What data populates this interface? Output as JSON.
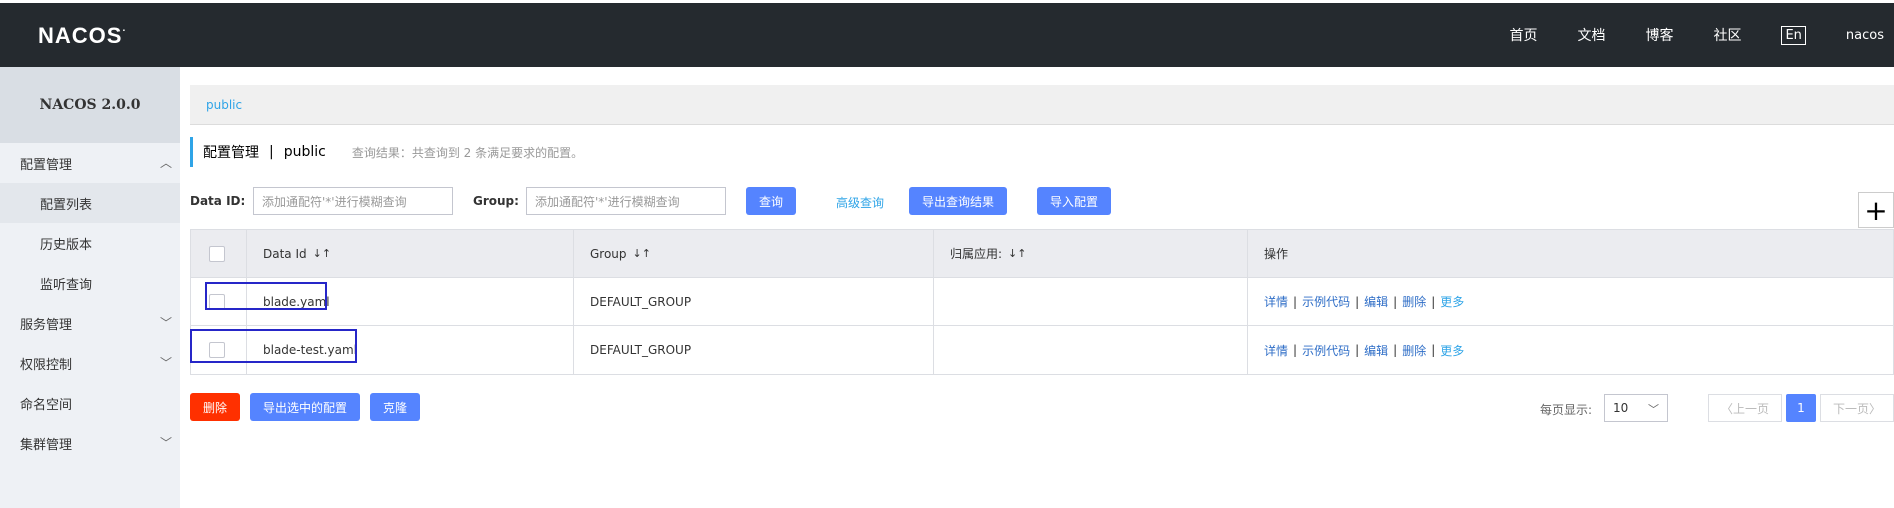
{
  "brand": {
    "logo_text": "NACOS",
    "logo_dot": "."
  },
  "topnav": {
    "items": [
      "首页",
      "文档",
      "博客",
      "社区"
    ],
    "lang": "En",
    "user": "nacos"
  },
  "sidebar": {
    "version": "NACOS 2.0.0",
    "groups": [
      {
        "label": "配置管理",
        "expanded": true,
        "items": [
          "配置列表",
          "历史版本",
          "监听查询"
        ]
      },
      {
        "label": "服务管理",
        "expanded": false
      },
      {
        "label": "权限控制",
        "expanded": false
      },
      {
        "label": "命名空间",
        "expanded": false
      },
      {
        "label": "集群管理",
        "expanded": false
      }
    ]
  },
  "namespace_bar": {
    "current": "public"
  },
  "title": {
    "main": "配置管理",
    "separator": "|",
    "namespace": "public",
    "result": "查询结果：共查询到 2 条满足要求的配置。"
  },
  "search": {
    "data_id_label": "Data ID:",
    "data_id_placeholder": "添加通配符'*'进行模糊查询",
    "group_label": "Group:",
    "group_placeholder": "添加通配符'*'进行模糊查询",
    "query_button": "查询",
    "advanced_link": "高级查询",
    "export_button": "导出查询结果",
    "import_button": "导入配置",
    "add_button": "+"
  },
  "table": {
    "headers": [
      "Data Id",
      "Group",
      "归属应用:",
      "操作"
    ],
    "rows": [
      {
        "data_id": "blade.yaml",
        "group": "DEFAULT_GROUP",
        "app": ""
      },
      {
        "data_id": "blade-test.yaml",
        "group": "DEFAULT_GROUP",
        "app": ""
      }
    ],
    "ops": [
      "详情",
      "示例代码",
      "编辑",
      "删除",
      "更多"
    ],
    "sort_glyph": "↓↑"
  },
  "footer": {
    "delete_button": "删除",
    "export_selected_button": "导出选中的配置",
    "clone_button": "克隆",
    "page_size_label": "每页显示:",
    "page_size_value": "10",
    "prev_label": "上一页",
    "current_page": "1",
    "next_label": "下一页"
  },
  "colors": {
    "topbar": "#252a2f",
    "primary": "#5584ff",
    "link": "#2fa4e7",
    "danger": "#ff3000",
    "highlight_box": "#2626c8"
  }
}
